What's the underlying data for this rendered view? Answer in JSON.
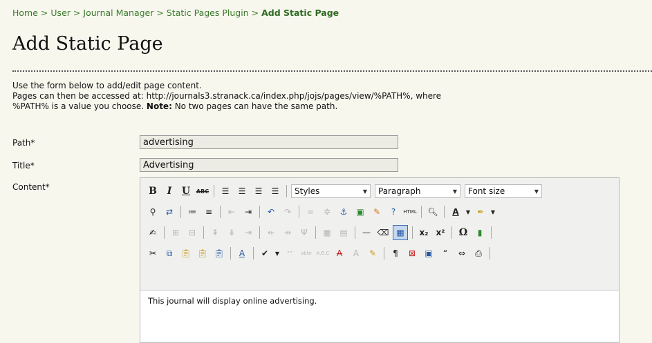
{
  "breadcrumb": {
    "items": [
      "Home",
      "User",
      "Journal Manager",
      "Static Pages Plugin"
    ],
    "separator": ">",
    "current": "Add Static Page"
  },
  "page": {
    "title": "Add Static Page"
  },
  "intro": {
    "line1": "Use the form below to add/edit page content.",
    "line2": "Pages can then be accessed at: http://journals3.stranack.ca/index.php/jojs/pages/view/%PATH%, where",
    "line3_start": "%PATH% is a value you choose. ",
    "note_label": "Note:",
    "line3_end": " No two pages can have the same path."
  },
  "form": {
    "path_label": "Path*",
    "path_value": "advertising",
    "title_label": "Title*",
    "title_value": "Advertising",
    "content_label": "Content*"
  },
  "editor": {
    "styles_select": "Styles",
    "paragraph_select": "Paragraph",
    "fontsize_select": "Font size",
    "content": "This journal will display online advertising."
  },
  "colors": {
    "page_bg": "#f7f7ee",
    "breadcrumb_link": "#3b7a2c"
  }
}
